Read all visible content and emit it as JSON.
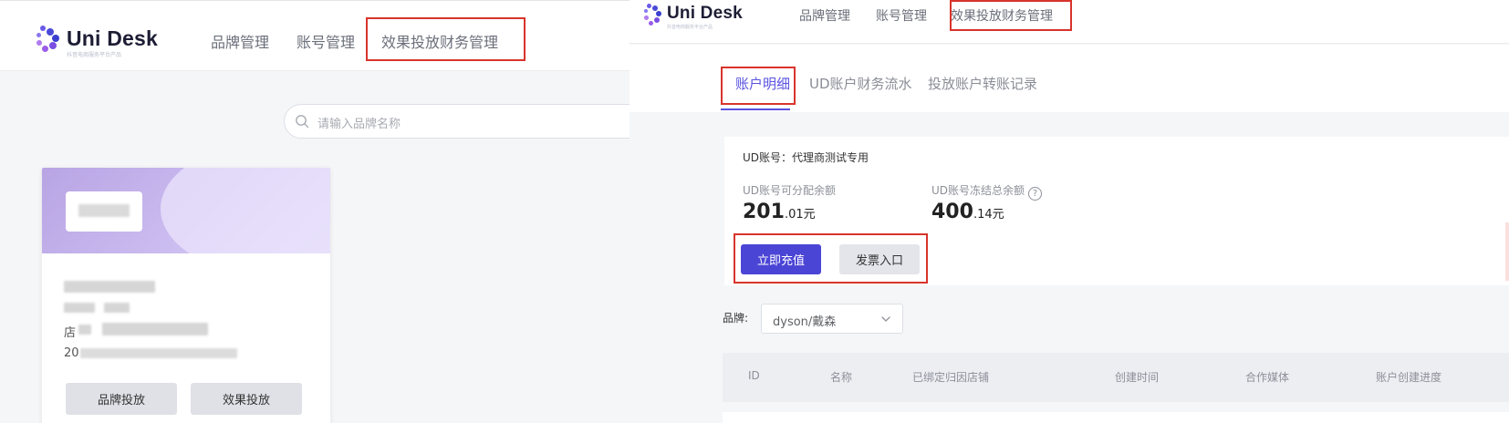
{
  "left": {
    "logo": {
      "text": "Uni Desk",
      "tagline": "抖音电商服务平台产品"
    },
    "nav": [
      "品牌管理",
      "账号管理",
      "效果投放财务管理"
    ],
    "search": {
      "placeholder": "请输入品牌名称"
    },
    "card": {
      "shop_prefix": "店",
      "date_prefix": "20",
      "buttons": [
        "品牌投放",
        "效果投放"
      ]
    }
  },
  "right": {
    "logo": {
      "text": "Uni Desk",
      "tagline": "抖音电商服务平台产品"
    },
    "nav": [
      "品牌管理",
      "账号管理",
      "效果投放财务管理"
    ],
    "tabs": [
      "账户明细",
      "UD账户财务流水",
      "投放账户转账记录"
    ],
    "account": {
      "title": "UD账号：代理商测试专用",
      "available_label": "UD账号可分配余额",
      "available_int": "201",
      "available_dec": ".01元",
      "frozen_label": "UD账号冻结总余额",
      "frozen_int": "400",
      "frozen_dec": ".14元",
      "help_glyph": "?",
      "recharge_button": "立即充值",
      "invoice_button": "发票入口"
    },
    "filter": {
      "brand_label": "品牌:",
      "brand_value": "dyson/戴森"
    },
    "table": {
      "columns": [
        "ID",
        "名称",
        "已绑定归因店铺",
        "创建时间",
        "合作媒体",
        "账户创建进度"
      ]
    }
  },
  "colors": {
    "accent": "#4b45d6",
    "highlight_box": "#d8342c",
    "banner": "#b8a4e4"
  },
  "icons": [
    "logo-mark-icon",
    "search-icon",
    "help-icon",
    "chevron-down-icon"
  ]
}
